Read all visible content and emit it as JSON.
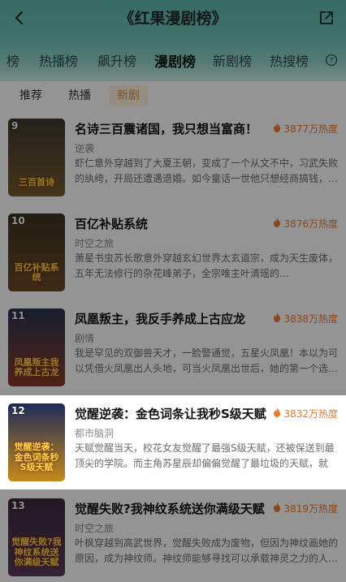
{
  "header": {
    "title": "《红果漫剧榜》"
  },
  "tabs": [
    "榜",
    "热播榜",
    "飙升榜",
    "漫剧榜",
    "新剧榜",
    "热搜榜"
  ],
  "subtabs": [
    "推荐",
    "热播",
    "新剧"
  ],
  "items": [
    {
      "rank": "9",
      "title": "名诗三百震诸国，我只想当富商！",
      "heat": "3877万热度",
      "genre": "逆袭",
      "desc": "虾仁意外穿越到了大夏王朝，变成了一个从文不中，习武失败的纨绔，开局还遭遇退婚。如今童话一世他只想经商搞钱，…",
      "cover_caption": "三百首诗",
      "cover_top": "#3a3a2f",
      "cover_bottom": "#7a5a2f"
    },
    {
      "rank": "10",
      "title": "百亿补贴系统",
      "heat": "3876万热度",
      "genre": "时空之旅",
      "desc": "萧星书虫苏长歌意外穿越玄幻世界太玄道宗，成为天生废体，五年无法修行的杂花峰弟子，全宗唯主叶清瑶的…",
      "cover_caption": "百亿补贴系统",
      "cover_top": "#3e3320",
      "cover_bottom": "#6a4a26"
    },
    {
      "rank": "11",
      "title": "凤凰叛主，我反手养成上古应龙",
      "heat": "3838万热度",
      "genre": "剧情",
      "desc": "我是罕见的双御兽天才，一脸警通觉，五星火凤凰！本以为可以凭借火凤凰出人头地，可当火凤凰出世后，她的第一个选…",
      "cover_caption": "凤凰叛主我养成上古龙",
      "cover_top": "#2a3550",
      "cover_bottom": "#8a3a2a"
    },
    {
      "rank": "12",
      "title": "觉醒逆袭：金色词条让我秒S级天赋",
      "heat": "3832万热度",
      "genre": "都市脑洞",
      "desc": "天赋觉醒当天，校花女友觉醒了最强S级天赋，还被保送到最顶尖的学院。而主角苏星辰却偏偏觉醒了最垃圾的天赋，就在…",
      "cover_caption": "觉醒逆袭：金色词条秒S级天赋",
      "cover_top": "#1d2a5a",
      "cover_bottom": "#c58a1a"
    },
    {
      "rank": "13",
      "title": "觉醒失败?我神纹系统送你满级天赋",
      "heat": "3819万热度",
      "genre": "时空之旅",
      "desc": "叶枫穿越到高武世界，觉醒失败成为废物，但因为神纹画她的原因，成为神纹师。神纹师能够寻找可以承载神灵之力的人…",
      "cover_caption": "觉醒失败?我神纹系统送你满级天赋",
      "cover_top": "#3a2a3a",
      "cover_bottom": "#5a3a5a"
    }
  ]
}
